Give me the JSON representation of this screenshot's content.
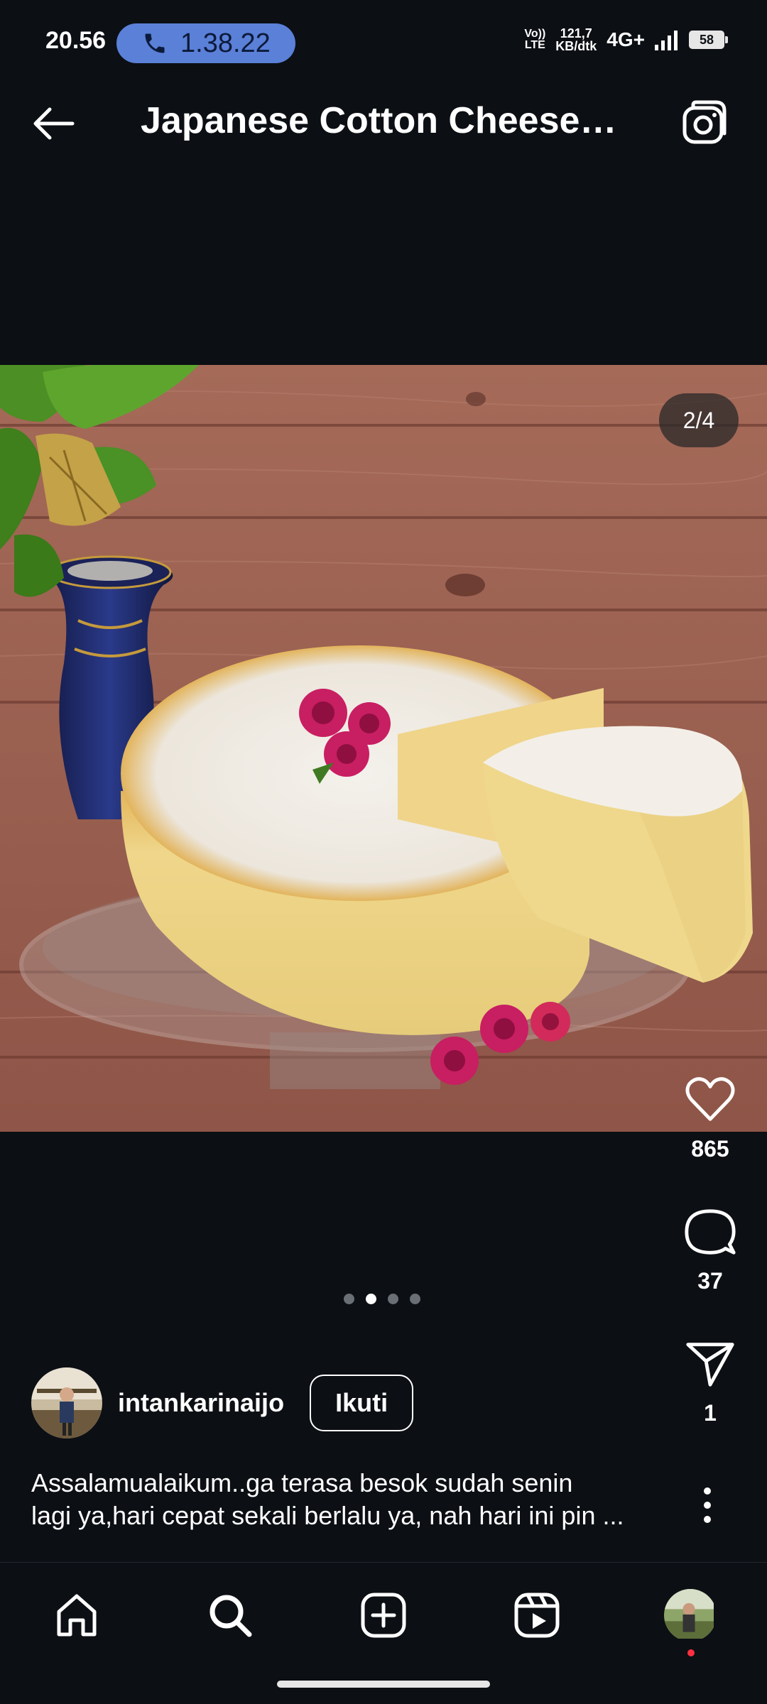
{
  "status_bar": {
    "time": "20.56",
    "call_duration": "1.38.22",
    "volte_top": "Vo))",
    "volte_bottom": "LTE",
    "speed_value": "121,7",
    "speed_unit": "KB/dtk",
    "network": "4G+",
    "battery": "58"
  },
  "header": {
    "title": "Japanese Cotton Cheese Cake"
  },
  "post": {
    "image_counter": "2/4",
    "carousel": {
      "total": 4,
      "active_index": 1
    },
    "likes": "865",
    "comments": "37",
    "shares": "1",
    "author": "intankarinaijo",
    "follow_label": "Ikuti",
    "caption_line1": "Assalamualaikum..ga terasa besok sudah senin",
    "caption_line2": "lagi ya,hari cepat sekali berlalu ya, nah hari ini pin ..."
  },
  "icons": {
    "back": "arrow-left-icon",
    "camera": "camera-icon",
    "like": "heart-icon",
    "comment": "comment-icon",
    "share": "send-icon",
    "more": "more-vertical-icon",
    "nav": [
      "home-icon",
      "search-icon",
      "create-icon",
      "reels-icon",
      "profile-avatar"
    ]
  },
  "colors": {
    "background": "#0c0f14",
    "call_pill": "#5a80d8",
    "accent_dot": "#ff3040"
  }
}
